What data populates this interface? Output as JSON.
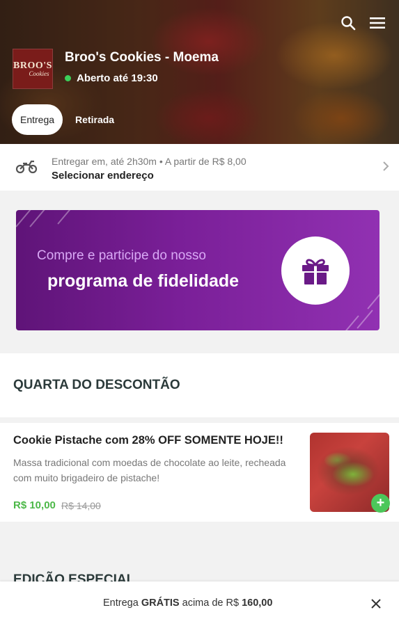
{
  "store": {
    "logo_text": "BROO'S",
    "logo_sub": "Cookies",
    "name": "Broo's Cookies - Moema",
    "status": "Aberto até 19:30"
  },
  "tabs": [
    {
      "label": "Entrega",
      "active": true
    },
    {
      "label": "Retirada",
      "active": false
    }
  ],
  "delivery": {
    "line1": "Entregar em, até 2h30m • A partir de R$ 8,00",
    "line2": "Selecionar endereço"
  },
  "banner": {
    "line1": "Compre e participe do nosso",
    "line2": "programa de fidelidade"
  },
  "sections": [
    {
      "title": "QUARTA DO DESCONTÃO"
    },
    {
      "title": "EDIÇÃO ESPECIAL"
    }
  ],
  "product": {
    "name": "Cookie Pistache com 28% OFF SOMENTE HOJE!!",
    "description": "Massa tradicional com moedas de chocolate ao leite, recheada com muito brigadeiro de pistache!",
    "price": "R$ 10,00",
    "old_price": "R$ 14,00",
    "add_label": "+"
  },
  "bottom": {
    "prefix": "Entrega ",
    "highlight": "GRÁTIS",
    "mid": " acima de R$ ",
    "amount": "160,00"
  },
  "colors": {
    "accent_green": "#4cb848",
    "banner_purple": "#7a1f98",
    "open_dot": "#3cd05a"
  },
  "icons": [
    "search-icon",
    "menu-icon",
    "motorcycle-icon",
    "chevron-right-icon",
    "gift-icon",
    "plus-icon",
    "close-icon"
  ]
}
